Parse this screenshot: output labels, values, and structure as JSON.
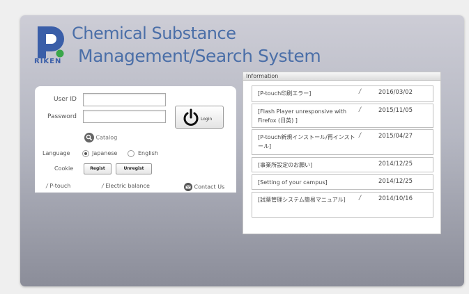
{
  "app": {
    "title_line1": "Chemical Substance",
    "title_line2": "Management/Search System",
    "logo_text": "RIKEN"
  },
  "login": {
    "user_id_label": "User ID",
    "password_label": "Password",
    "user_id_value": "",
    "password_value": "",
    "login_label": "Login",
    "catalog_label": "Catalog",
    "language_label": "Language",
    "language_options": [
      "Japanese",
      "English"
    ],
    "language_selected": "Japanese",
    "cookie_label": "Cookie",
    "regist_label": "Regist",
    "unregist_label": "Unregist"
  },
  "links": {
    "ptouch": "P-touch",
    "electric_balance": "Electric balance",
    "contact_us": "Contact Us"
  },
  "information": {
    "header": "Information",
    "items": [
      {
        "title": "[P-touch印刷エラー]",
        "attachment": true,
        "date": "2016/03/02"
      },
      {
        "title": "[Flash Player unresponsive with Firefox (日英) ]",
        "attachment": true,
        "date": "2015/11/05"
      },
      {
        "title": "[P-touch新規インストール/再インストール]",
        "attachment": true,
        "date": "2015/04/27"
      },
      {
        "title": "[事業所設定のお願い]",
        "attachment": false,
        "date": "2014/12/25"
      },
      {
        "title": "[Setting of your campus]",
        "attachment": false,
        "date": "2014/12/25"
      },
      {
        "title": "[試薬管理システム簡易マニュアル]",
        "attachment": true,
        "date": "2014/10/16"
      }
    ]
  },
  "colors": {
    "title": "#4b6fa8",
    "logo_blue": "#3a5ea8",
    "logo_green": "#3aa64a"
  },
  "icons": {
    "power": "power-icon",
    "search": "search-icon",
    "attachment": "paperclip-icon",
    "mail": "mail-icon"
  }
}
